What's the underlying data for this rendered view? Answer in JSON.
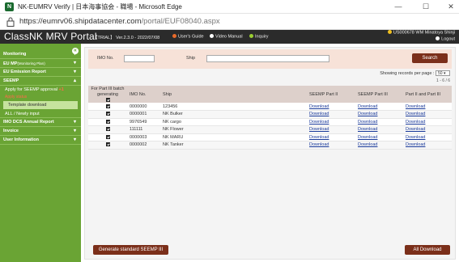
{
  "window": {
    "title": "NK-EUMRV Verify | 日本海事協会 - 職場 - Microsoft Edge",
    "controls": [
      "—",
      "☐",
      "✕"
    ]
  },
  "address": {
    "host": "https://eumrv06.shipdatacenter.com",
    "path": "/portal/EUF08040.aspx"
  },
  "header": {
    "brand": "ClassNK MRV Portal",
    "meta": "【TRIAL】 Ver.2.3.0 - 2022/07/08",
    "users_guide": "User's Guide",
    "video_manual": "Video Manual",
    "inquiry": "Inquiry",
    "user": "US000678 WM Minatoya Shinji",
    "logout": "Logout"
  },
  "sidebar": {
    "collapse_icon": "«",
    "items": [
      {
        "label": "Monitoring"
      },
      {
        "label": "EU MP",
        "suffix": "(Monitoring Plan)"
      },
      {
        "label": "EU Emission Report"
      },
      {
        "label": "SEEMP"
      }
    ],
    "seemp_sub": {
      "apply": "Apply for SEEMP approval",
      "apply_badge": "+1",
      "red_note": "Apply status",
      "template": "Template download",
      "all_newly": "ALL / Newly input"
    },
    "items_after": [
      {
        "label": "IMO DCS Annual Report"
      },
      {
        "label": "Invoice"
      },
      {
        "label": "User Information"
      }
    ]
  },
  "search": {
    "imo_label": "IMO No.",
    "ship_label": "Ship",
    "imo_value": "",
    "ship_value": "",
    "button": "Search"
  },
  "paging": {
    "label": "Showing records per page :",
    "value": "50",
    "count": "1 - 6 / 6"
  },
  "table": {
    "headers": {
      "batch": "For Part III batch generating",
      "imo": "IMO No.",
      "ship": "Ship",
      "p2": "SEEMP Part II",
      "p3": "SEEMP Part III",
      "p23": "Part II and Part III"
    },
    "rows": [
      {
        "imo": "0000000",
        "ship": "123456",
        "p2": "Download",
        "p3": "Download",
        "p23": "Download"
      },
      {
        "imo": "0000001",
        "ship": "NK Bulker",
        "p2": "Download",
        "p3": "Download",
        "p23": "Download"
      },
      {
        "imo": "9976549",
        "ship": "NK cargo",
        "p2": "Download",
        "p3": "Download",
        "p23": "Download"
      },
      {
        "imo": "111111",
        "ship": "NK Flower",
        "p2": "Download",
        "p3": "Download",
        "p23": "Download"
      },
      {
        "imo": "0000003",
        "ship": "NK MARU",
        "p2": "Download",
        "p3": "Download",
        "p23": "Download"
      },
      {
        "imo": "0000002",
        "ship": "NK Tanker",
        "p2": "Download",
        "p3": "Download",
        "p23": "Download"
      }
    ]
  },
  "buttons": {
    "generate": "Generate standard SEEMP III",
    "all_download": "All Download"
  },
  "colors": {
    "sidebar": "#6aa434",
    "header": "#2b2b2b",
    "button": "#7b2f1a",
    "search_bg": "#f7e2d8"
  }
}
